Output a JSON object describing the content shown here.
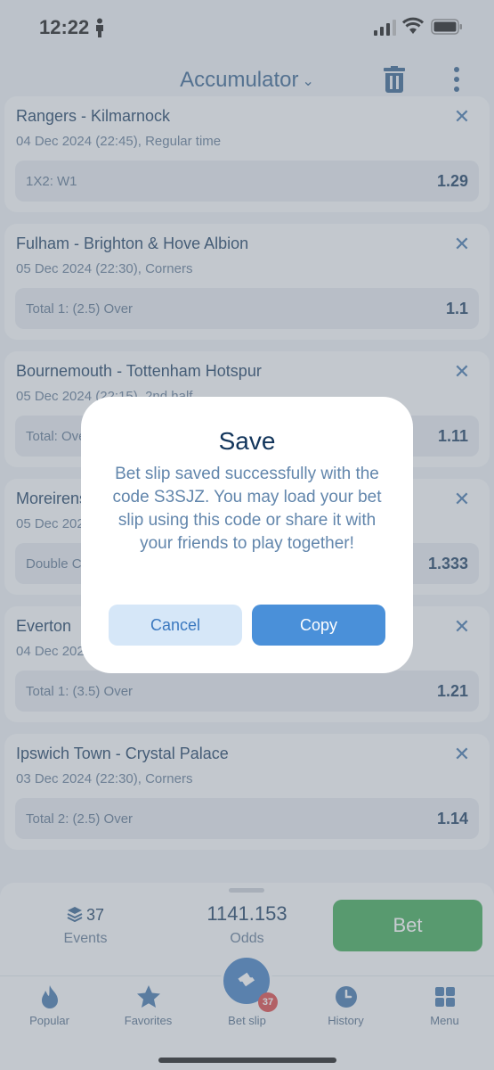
{
  "status_bar": {
    "time": "12:22"
  },
  "header": {
    "title": "Accumulator"
  },
  "bets": [
    {
      "match": "Rangers - Kilmarnock",
      "meta": "04 Dec 2024 (22:45), Regular time",
      "market": "1X2: W1",
      "odds": "1.29"
    },
    {
      "match": "Fulham - Brighton & Hove Albion",
      "meta": "05 Dec 2024 (22:30), Corners",
      "market": "Total 1: (2.5) Over",
      "odds": "1.1"
    },
    {
      "match": "Bournemouth - Tottenham Hotspur",
      "meta": "05 Dec 2024 (22:15), 2nd half",
      "market": "Total: Over",
      "odds": "1.11"
    },
    {
      "match": "Moreirense",
      "meta": "05 Dec 2024",
      "market": "Double Chance",
      "odds": "1.333"
    },
    {
      "match": "Everton",
      "meta": "04 Dec 2024",
      "market": "Total 1: (3.5) Over",
      "odds": "1.21"
    },
    {
      "match": "Ipswich Town - Crystal Palace",
      "meta": "03 Dec 2024 (22:30), Corners",
      "market": "Total 2: (2.5) Over",
      "odds": "1.14"
    }
  ],
  "summary": {
    "events_count": "37",
    "events_label": "Events",
    "odds_value": "1141.153",
    "odds_label": "Odds",
    "bet_label": "Bet"
  },
  "tabs": [
    {
      "label": "Popular",
      "icon": "flame-icon"
    },
    {
      "label": "Favorites",
      "icon": "star-icon"
    },
    {
      "label": "Bet slip",
      "icon": "ticket-icon",
      "badge": "37"
    },
    {
      "label": "History",
      "icon": "clock-icon"
    },
    {
      "label": "Menu",
      "icon": "grid-icon"
    }
  ],
  "modal": {
    "title": "Save",
    "message": "Bet slip saved successfully with the code S3SJZ. You may load your bet slip using this code or share it with your friends to play together!",
    "cancel_label": "Cancel",
    "copy_label": "Copy"
  },
  "colors": {
    "accent": "#3a78bf",
    "bet_green": "#36a64f",
    "title_navy": "#12355b",
    "badge_red": "#d93f3f"
  }
}
